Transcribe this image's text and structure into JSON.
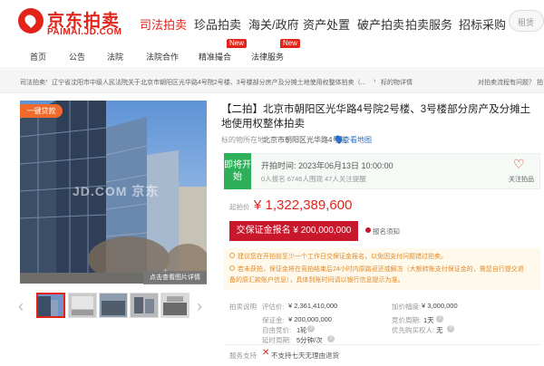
{
  "header": {
    "logo_cn": "京东拍卖",
    "logo_en": "PAIMAI.JD.COM",
    "nav": [
      "司法拍卖",
      "珍品拍卖",
      "海关/政府",
      "资产处置",
      "破产拍卖",
      "拍卖服务",
      "招标采购"
    ],
    "active_nav": "司法拍卖",
    "search_placeholder": "租赁"
  },
  "subnav": {
    "items": [
      "首页",
      "公告",
      "法院",
      "法院合作",
      "精准撮合",
      "法律服务"
    ],
    "new_badge": "New"
  },
  "breadcrumb": {
    "items": [
      "司法拍卖",
      "辽宁省沈阳市中级人民法院关于北京市朝阳区光华路4号院2号楼、3号楼部分房产及分摊土地使用权整体拍卖（...",
      "标的物详情"
    ],
    "help": "对拍卖流程有问题？ 拍"
  },
  "gallery": {
    "badge": "一键贷款",
    "watermark": "JD.COM 京东",
    "view_all": "点击查看图片详情"
  },
  "item": {
    "title": "【二拍】北京市朝阳区光华路4号院2号楼、3号楼部分房产及分摊土地使用权整体拍卖",
    "location_label": "标的物所在地:",
    "location": "北京市朝阳区光华路4号院",
    "map_link": "查看地图"
  },
  "status": {
    "label": "即将开始",
    "start_time": "开拍时间: 2023年06月13日 10:00:00",
    "stats": "0人报名  6746人围观  47人关注提醒",
    "follow": "关注拍品"
  },
  "price": {
    "label": "起拍价",
    "value": "¥ 1,322,389,600"
  },
  "deposit": {
    "button": "交保证金报名 ¥ 200,000,000",
    "notice": "报名须知"
  },
  "tips": [
    "建议您在开拍前至少一个工作日交保证金报名，以免因支付问题错过拍卖。",
    "若未获拍，保证金将在竞拍结束后24小时内原路返还或解冻（大额转账支付保证金的，需您自行提交退",
    "        备的原汇款账户信息），具体到账时间请以银行信息提示为准。"
  ],
  "info": {
    "heading": "拍卖说明",
    "rows": [
      {
        "k": "评估价:",
        "v": "¥ 2,361,410,000",
        "k2": "加价幅度:",
        "v2": "¥ 3,000,000"
      },
      {
        "k": "保证金:",
        "v": "¥ 200,000,000",
        "k2": "竞价周期:",
        "v2": "1天"
      },
      {
        "k": "自由竞价:",
        "v": "1轮",
        "k2": "优先购买权人:",
        "v2": "无"
      },
      {
        "k": "延时周期:",
        "v": "5分钟/次"
      }
    ],
    "service_label": "服务支持",
    "service": "不支持七天无理由退货"
  },
  "colors": {
    "brand": "#e2231a",
    "status_green": "#2eb05a",
    "deposit_red": "#c9172b",
    "link_blue": "#2a6fc9"
  }
}
